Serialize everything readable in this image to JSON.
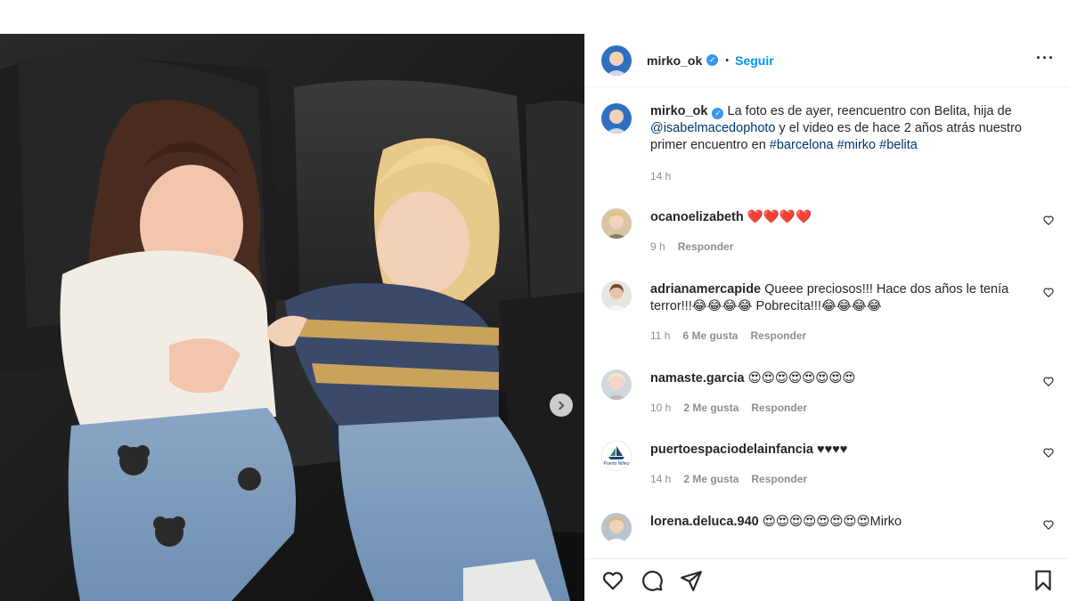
{
  "header": {
    "username": "mirko_ok",
    "verified_mark": "✓",
    "separator": "•",
    "follow_label": "Seguir",
    "more_label": "···"
  },
  "caption": {
    "username": "mirko_ok",
    "verified_mark": "✓",
    "text_1": " La foto es de ayer, reencuentro con Belita, hija de ",
    "mention": "@isabelmacedophoto",
    "text_2": " y el video es de hace 2 años atrás nuestro primer encuentro en ",
    "tag_1": "#barcelona",
    "tag_2": "#mirko",
    "tag_3": "#belita",
    "time": "14 h"
  },
  "comments": [
    {
      "username": "ocanoelizabeth",
      "text": "❤️❤️❤️❤️",
      "time": "9 h",
      "likes": "",
      "reply": "Responder"
    },
    {
      "username": "adrianamercapide",
      "text": "Queee preciosos!!! Hace dos años le tenía terror!!!😂😂😂😂 Pobrecita!!!😂😂😂😂",
      "time": "11 h",
      "likes": "6 Me gusta",
      "reply": "Responder"
    },
    {
      "username": "namaste.garcia",
      "text": "😍😍😍😍😍😍😍😍",
      "time": "10 h",
      "likes": "2 Me gusta",
      "reply": "Responder"
    },
    {
      "username": "puertoespaciodelainfancia",
      "text": "♥♥♥♥",
      "time": "14 h",
      "likes": "2 Me gusta",
      "reply": "Responder"
    },
    {
      "username": "lorena.deluca.940",
      "text": "😍😍😍😍😍😍😍😍Mirko",
      "time": "",
      "likes": "",
      "reply": ""
    }
  ],
  "avatar_logo_text": "Puerto Niñez",
  "colors": {
    "accent": "#0095f6",
    "link": "#00376b",
    "muted": "#8e8e8e",
    "verified": "#3897f0"
  },
  "icons": [
    "heart-icon",
    "comment-icon",
    "share-icon",
    "bookmark-icon",
    "chevron-right-icon"
  ]
}
